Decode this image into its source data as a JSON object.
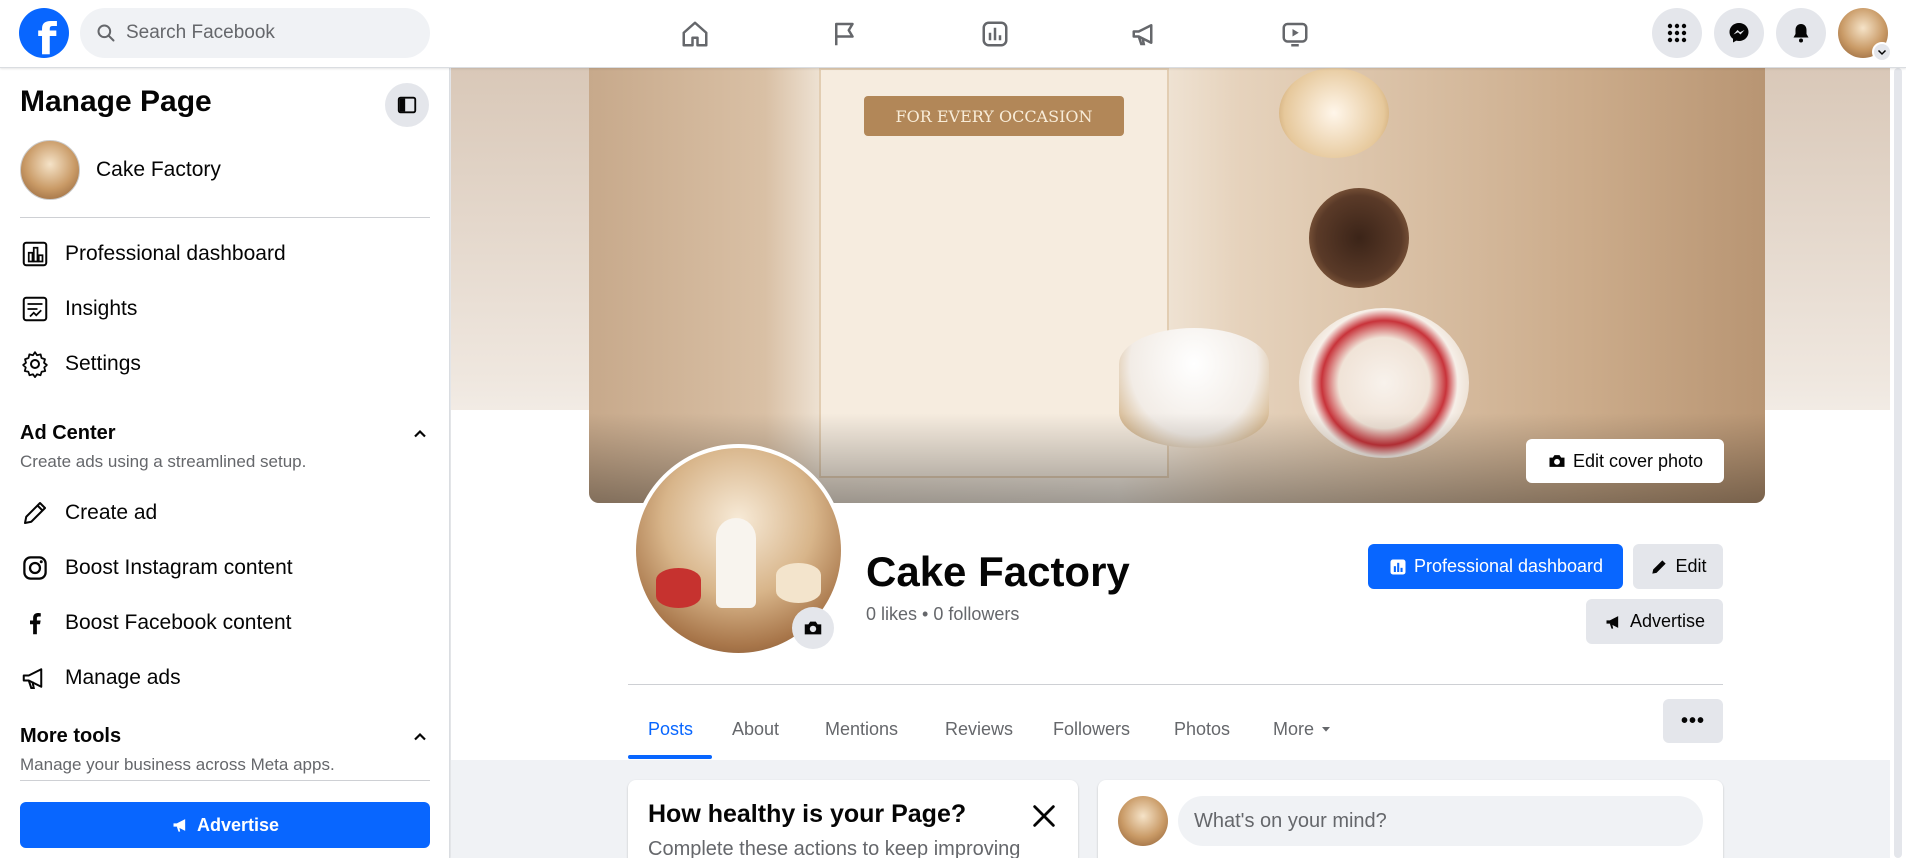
{
  "topbar": {
    "search_placeholder": "Search Facebook",
    "nav": [
      "home-icon",
      "flag-icon",
      "chart-icon",
      "megaphone-icon",
      "video-icon"
    ],
    "right": [
      "menu-grid-icon",
      "messenger-icon",
      "bell-icon"
    ]
  },
  "sidebar": {
    "title": "Manage Page",
    "page_name": "Cake Factory",
    "items": [
      {
        "label": "Professional dashboard",
        "icon": "dashboard-icon"
      },
      {
        "label": "Insights",
        "icon": "insights-icon"
      },
      {
        "label": "Settings",
        "icon": "gear-icon"
      }
    ],
    "ad_center": {
      "title": "Ad Center",
      "subtitle": "Create ads using a streamlined setup.",
      "items": [
        {
          "label": "Create ad",
          "icon": "pencil-icon"
        },
        {
          "label": "Boost Instagram content",
          "icon": "instagram-icon"
        },
        {
          "label": "Boost Facebook content",
          "icon": "facebook-icon"
        },
        {
          "label": "Manage ads",
          "icon": "megaphone-icon"
        }
      ]
    },
    "more_tools": {
      "title": "More tools",
      "subtitle": "Manage your business across Meta apps."
    },
    "advertise_label": "Advertise"
  },
  "cover": {
    "banner_text": "FOR EVERY OCCASION",
    "edit_label": "Edit cover photo"
  },
  "page": {
    "name": "Cake Factory",
    "stats": "0 likes • 0 followers"
  },
  "actions": {
    "dashboard_label": "Professional dashboard",
    "edit_label": "Edit",
    "advertise_label": "Advertise"
  },
  "tabs": [
    {
      "label": "Posts",
      "active": true
    },
    {
      "label": "About"
    },
    {
      "label": "Mentions"
    },
    {
      "label": "Reviews"
    },
    {
      "label": "Followers"
    },
    {
      "label": "Photos"
    },
    {
      "label": "More"
    }
  ],
  "more_dots": "•••",
  "health_card": {
    "title": "How healthy is your Page?",
    "subtitle": "Complete these actions to keep improving"
  },
  "composer": {
    "placeholder": "What's on your mind?"
  },
  "colors": {
    "brand": "#0866ff",
    "grey_button": "#e4e6eb",
    "background": "#f0f2f5"
  }
}
